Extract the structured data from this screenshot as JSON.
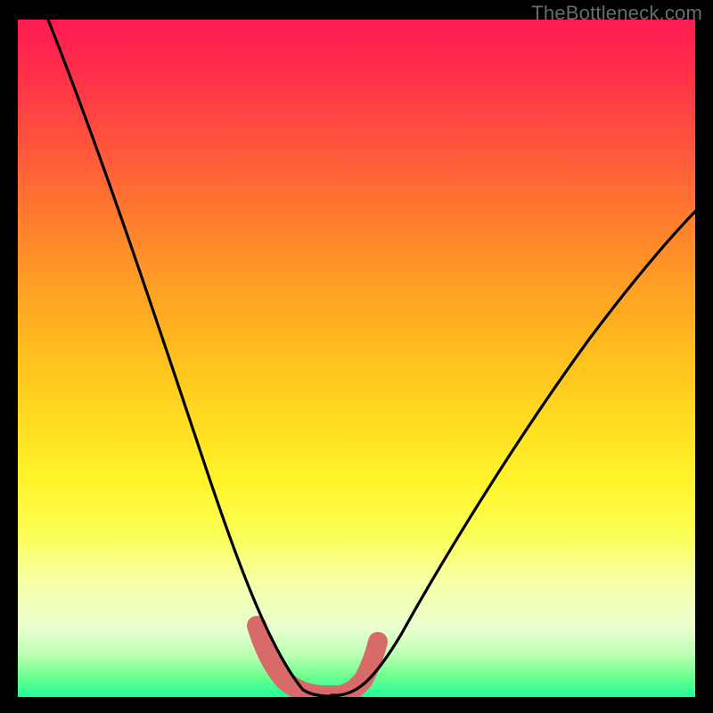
{
  "watermark": "TheBottleneck.com",
  "chart_data": {
    "type": "line",
    "title": "",
    "xlabel": "",
    "ylabel": "",
    "xlim": [
      0,
      100
    ],
    "ylim": [
      0,
      100
    ],
    "grid": false,
    "series": [
      {
        "name": "bottleneck-curve",
        "x": [
          4,
          8,
          12,
          16,
          20,
          24,
          28,
          32,
          34,
          36,
          38,
          40,
          42,
          44,
          46,
          48,
          52,
          56,
          60,
          66,
          72,
          80,
          88,
          96,
          100
        ],
        "values": [
          100,
          90,
          80,
          70,
          60,
          50,
          40,
          28,
          22,
          16,
          10,
          4,
          1,
          0,
          0,
          1,
          4,
          10,
          16,
          24,
          32,
          42,
          52,
          60,
          64
        ]
      }
    ],
    "annotations": [
      {
        "name": "minimum-band",
        "x_start": 36,
        "x_end": 50,
        "value": 0
      }
    ],
    "background_gradient": {
      "top": "#ff1a52",
      "mid": "#ffe033",
      "bottom": "#20ff9a"
    }
  }
}
